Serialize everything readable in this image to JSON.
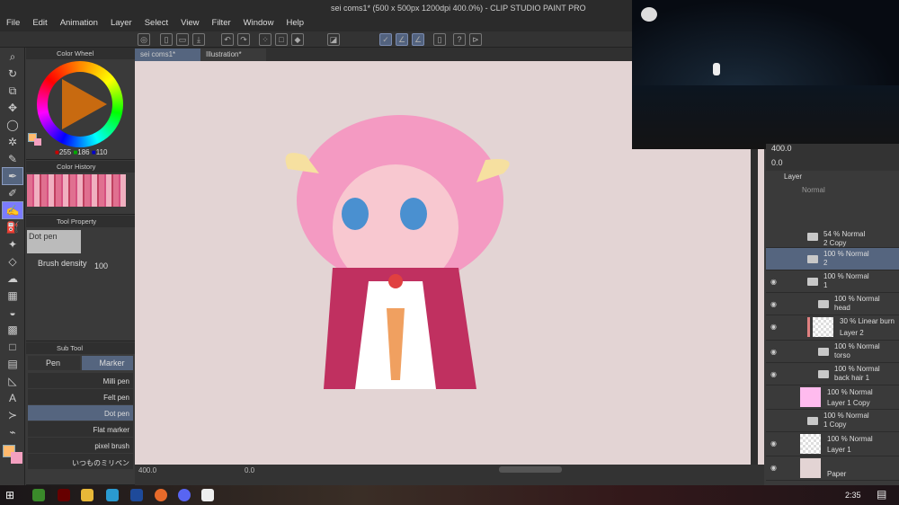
{
  "window": {
    "title": "sei coms1* (500 x 500px 1200dpi 400.0%)  - CLIP STUDIO PAINT PRO"
  },
  "menu": [
    "File",
    "Edit",
    "Animation",
    "Layer",
    "Select",
    "View",
    "Filter",
    "Window",
    "Help"
  ],
  "tabs": [
    {
      "label": "sei coms1*"
    },
    {
      "label": "Illustration*"
    }
  ],
  "color_wheel": {
    "title": "Color Wheel",
    "r": "255",
    "g": "186",
    "b": "110",
    "main_color": "#ffba6e",
    "sub_color": "#f4a0c0"
  },
  "color_history": {
    "title": "Color History"
  },
  "tool_property": {
    "title": "Tool Property",
    "tool_name": "Dot pen",
    "brush_density_label": "Brush density",
    "brush_density": "100"
  },
  "sub_tool": {
    "title": "Sub Tool",
    "groups": [
      "Pen",
      "Marker"
    ],
    "items": [
      "Milli pen",
      "Felt pen",
      "Dot pen",
      "Flat marker",
      "pixel brush",
      "いつものミリペン"
    ]
  },
  "status": {
    "zoom": "400.0",
    "angle": "0.0"
  },
  "navigator": {
    "zoom": "400.0",
    "angle": "0.0"
  },
  "layer_panel": {
    "title": "Layer",
    "blend_mode": "Normal",
    "layers": [
      {
        "line1": "54 % Normal",
        "line2": "2 Copy"
      },
      {
        "line1": "100 % Normal",
        "line2": "2"
      },
      {
        "line1": "100 % Normal",
        "line2": "1"
      },
      {
        "line1": "100 % Normal",
        "line2": "head"
      },
      {
        "line1": "30 % Linear burn",
        "line2": "Layer 2"
      },
      {
        "line1": "100 % Normal",
        "line2": "torso"
      },
      {
        "line1": "100 % Normal",
        "line2": "back hair 1"
      },
      {
        "line1": "100 % Normal",
        "line2": "Layer 1 Copy"
      },
      {
        "line1": "100 % Normal",
        "line2": "1 Copy"
      },
      {
        "line1": "100 % Normal",
        "line2": "Layer 1"
      },
      {
        "line1": "",
        "line2": "Paper"
      }
    ]
  },
  "taskbar": {
    "time": "2:35"
  }
}
